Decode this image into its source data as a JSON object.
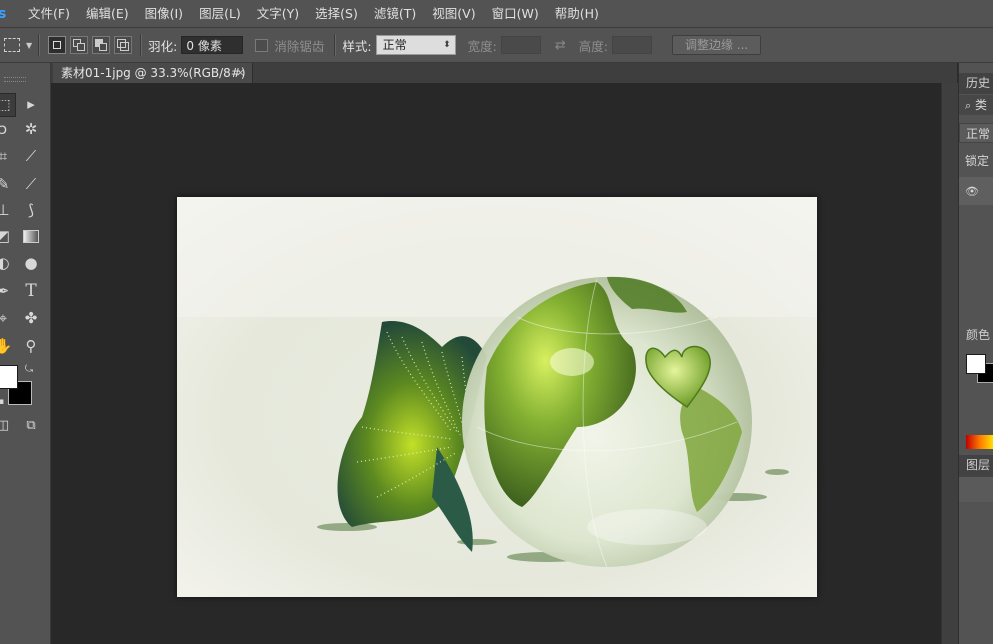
{
  "app": {
    "logo": "s"
  },
  "menu": [
    "文件(F)",
    "编辑(E)",
    "图像(I)",
    "图层(L)",
    "文字(Y)",
    "选择(S)",
    "滤镜(T)",
    "视图(V)",
    "窗口(W)",
    "帮助(H)"
  ],
  "options": {
    "feather_label": "羽化:",
    "feather_value": "0 像素",
    "antialias_label": "消除锯齿",
    "style_label": "样式:",
    "style_value": "正常",
    "width_label": "宽度:",
    "width_value": "",
    "height_label": "高度:",
    "height_value": "",
    "refine_edge_label": "调整边缘 ..."
  },
  "document": {
    "tab_title": "素材01-1jpg @ 33.3%(RGB/8#)",
    "close_glyph": "×"
  },
  "toolbar": {
    "type_tool_glyph": "T"
  },
  "right_panel": {
    "history_tab": "历史",
    "search_glyph": "⌕",
    "search_partial": "类",
    "blend_mode_partial": "正常",
    "lock_label": "锁定",
    "color_tab": "颜色",
    "layers_tab": "图层"
  },
  "colors": {
    "ui_bg": "#535353",
    "canvas_bg": "#282828",
    "accent_logo": "#3aa0ff",
    "foreground_swatch": "#ffffff",
    "background_swatch": "#000000"
  }
}
